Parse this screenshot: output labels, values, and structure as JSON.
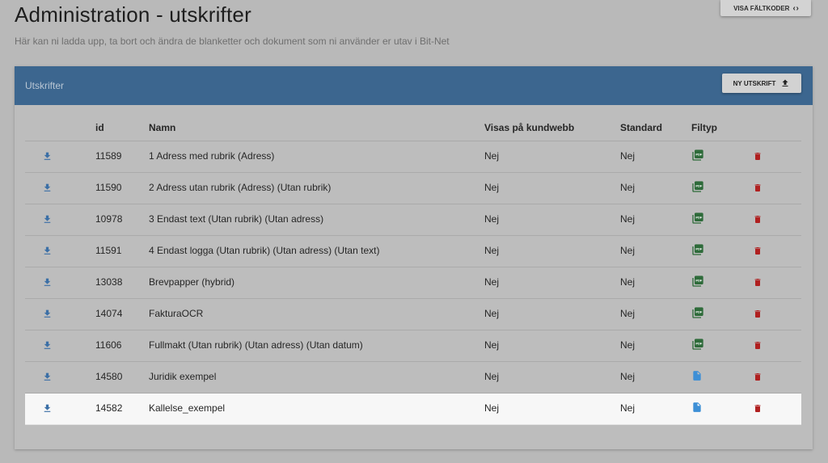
{
  "header": {
    "title": "Administration - utskrifter",
    "subtitle": "Här kan ni ladda upp, ta bort och ändra de blanketter och dokument som ni använder er utav i Bit-Net",
    "field_codes_label": "VISA FÄLTKODER",
    "field_codes_icon": "chevrons-code-icon"
  },
  "card": {
    "title": "Utskrifter",
    "new_button_label": "NY UTSKRIFT",
    "new_button_icon": "upload-icon"
  },
  "table": {
    "columns": [
      "",
      "id",
      "Namn",
      "Visas på kundwebb",
      "Standard",
      "Filtyp",
      ""
    ],
    "rows": [
      {
        "id": "11589",
        "name": "1 Adress med rubrik (Adress)",
        "visas": "Nej",
        "standard": "Nej",
        "filetype": "pdf"
      },
      {
        "id": "11590",
        "name": "2 Adress utan rubrik (Adress) (Utan rubrik)",
        "visas": "Nej",
        "standard": "Nej",
        "filetype": "pdf"
      },
      {
        "id": "10978",
        "name": "3 Endast text (Utan rubrik) (Utan adress)",
        "visas": "Nej",
        "standard": "Nej",
        "filetype": "pdf"
      },
      {
        "id": "11591",
        "name": "4 Endast logga (Utan rubrik) (Utan adress) (Utan text)",
        "visas": "Nej",
        "standard": "Nej",
        "filetype": "pdf"
      },
      {
        "id": "13038",
        "name": "Brevpapper (hybrid)",
        "visas": "Nej",
        "standard": "Nej",
        "filetype": "pdf"
      },
      {
        "id": "14074",
        "name": "FakturaOCR",
        "visas": "Nej",
        "standard": "Nej",
        "filetype": "pdf"
      },
      {
        "id": "11606",
        "name": "Fullmakt (Utan rubrik) (Utan adress) (Utan datum)",
        "visas": "Nej",
        "standard": "Nej",
        "filetype": "pdf"
      },
      {
        "id": "14580",
        "name": "Juridik exempel",
        "visas": "Nej",
        "standard": "Nej",
        "filetype": "doc"
      },
      {
        "id": "14582",
        "name": "Kallelse_exempel",
        "visas": "Nej",
        "standard": "Nej",
        "filetype": "doc",
        "highlighted": true
      }
    ]
  },
  "colors": {
    "header_blue": "#3c668f",
    "download_blue": "#3b6fa6",
    "pdf_green": "#2e6b3a",
    "doc_blue": "#3d8fd6",
    "delete_red": "#b02020"
  }
}
